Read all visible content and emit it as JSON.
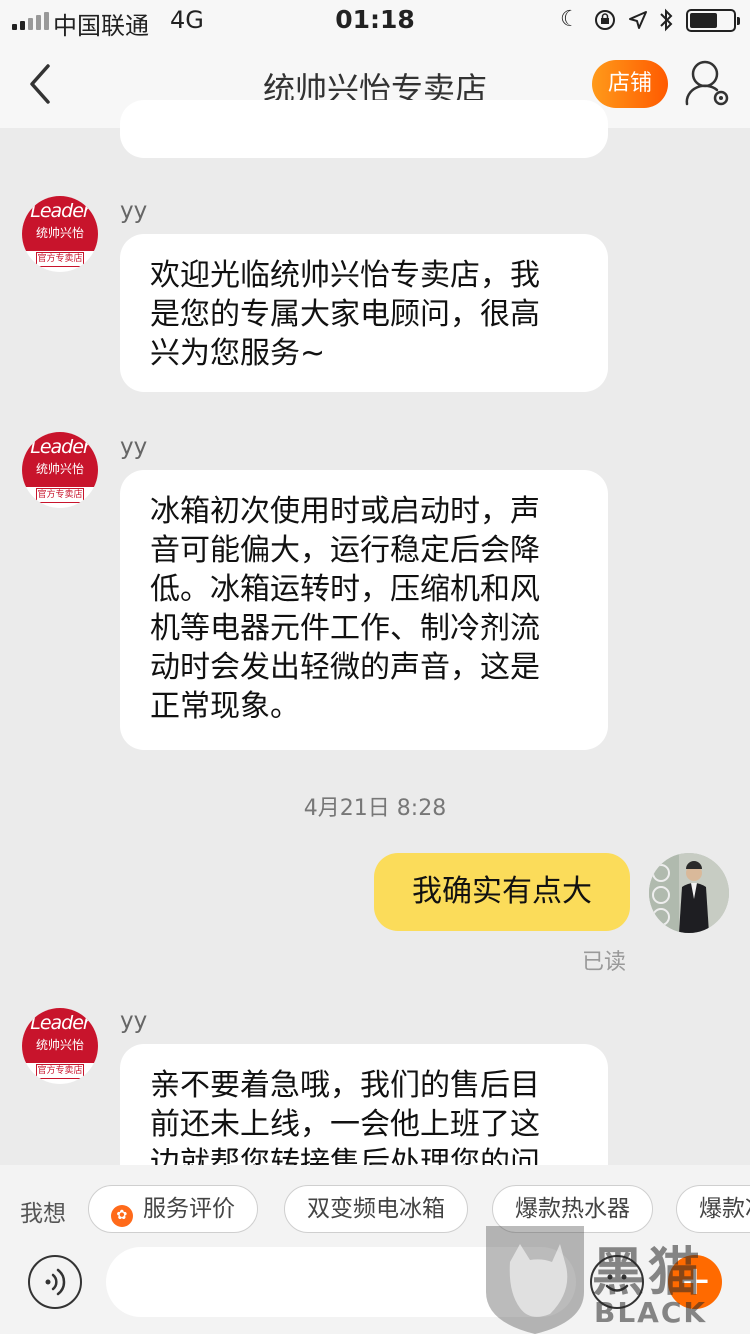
{
  "status_bar": {
    "carrier": "中国联通",
    "network": "4G",
    "time": "01:18",
    "icons": [
      "moon-icon",
      "rotation-lock-icon",
      "location-icon",
      "bluetooth-icon",
      "battery-icon"
    ]
  },
  "header": {
    "title": "统帅兴怡专卖店",
    "shop_button": "店铺",
    "icons": [
      "back-chevron-icon",
      "customer-service-icon"
    ]
  },
  "shop_avatar": {
    "brand": "Leader",
    "brand_cn": "统帅兴怡",
    "tag": "官方专卖店"
  },
  "messages": [
    {
      "sender": "yy",
      "lines": [
        "欢迎光临统帅兴怡专卖店，我",
        "是您的专属大家电顾问，很高",
        "兴为您服务~"
      ]
    },
    {
      "sender": "yy",
      "lines": [
        "冰箱初次使用时或启动时，声",
        "音可能偏大，运行稳定后会降",
        "低。冰箱运转时，压缩机和风",
        "机等电器元件工作、制冷剂流",
        "动时会发出轻微的声音，这是",
        "正常现象。"
      ]
    },
    {
      "timestamp": "4月21日 8:28"
    },
    {
      "sender": "me",
      "text": "我确实有点大",
      "read_status": "已读"
    },
    {
      "sender": "yy",
      "lines": [
        "亲不要着急哦，我们的售后目",
        "前还未上线，一会他上班了这",
        "边就帮您转接售后处理您的问"
      ]
    }
  ],
  "quick_replies": {
    "label": "我想",
    "items": [
      "服务评价",
      "双变频电冰箱",
      "爆款热水器",
      "爆款冰"
    ]
  },
  "input_bar": {
    "placeholder": "",
    "icons": [
      "voice-icon",
      "emoji-icon",
      "plus-icon"
    ]
  },
  "watermark": {
    "text_cn": "黑猫",
    "text_en": "BLACK CAT"
  },
  "colors": {
    "shop_button": "#ff6a00",
    "my_bubble": "#fbdc5a",
    "brand_red": "#c8142c",
    "background": "#ebebeb"
  }
}
